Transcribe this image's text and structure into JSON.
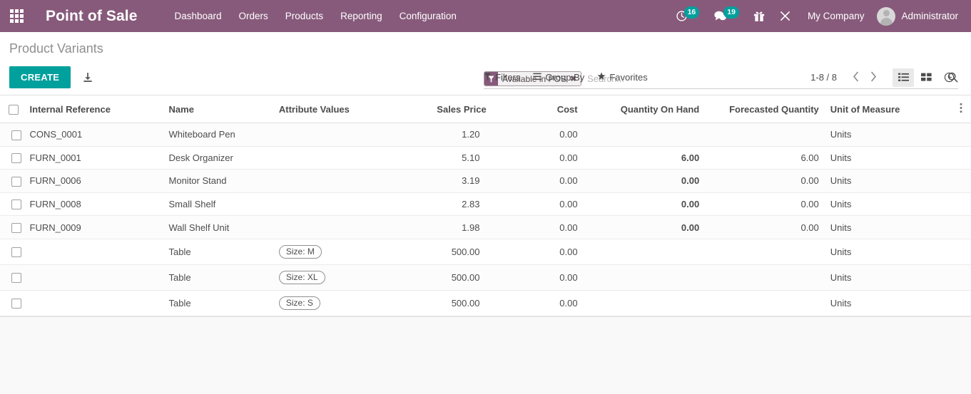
{
  "navbar": {
    "apps_icon": "apps-grid-icon",
    "brand": "Point of Sale",
    "menu": [
      {
        "label": "Dashboard"
      },
      {
        "label": "Orders"
      },
      {
        "label": "Products"
      },
      {
        "label": "Reporting"
      },
      {
        "label": "Configuration"
      }
    ],
    "systray": {
      "activities": {
        "icon": "clock-icon",
        "count": "16"
      },
      "messages": {
        "icon": "chat-bubble-icon",
        "count": "19"
      },
      "gift": {
        "icon": "gift-icon"
      },
      "tools": {
        "icon": "wrench-cross-icon"
      },
      "company": "My Company",
      "avatar_icon": "user-avatar-icon",
      "username": "Administrator"
    }
  },
  "control_panel": {
    "title": "Product Variants",
    "create_label": "CREATE",
    "import_icon": "import-download-icon",
    "search": {
      "facet": {
        "icon": "filter-funnel-icon",
        "label": "Available in POS",
        "close": "✖"
      },
      "placeholder": "Search...",
      "value": "",
      "search_icon": "search-icon"
    },
    "dropdowns": [
      {
        "icon": "filter-funnel-icon",
        "label": "Filters"
      },
      {
        "icon": "list-lines-icon",
        "label": "Group By"
      },
      {
        "icon": "star-icon",
        "label": "Favorites"
      }
    ],
    "pager": {
      "range": "1-8 / 8",
      "prev_icon": "chevron-left-icon",
      "next_icon": "chevron-right-icon"
    },
    "view_switcher": [
      {
        "icon": "list-view-icon",
        "active": true
      },
      {
        "icon": "kanban-view-icon",
        "active": false
      },
      {
        "icon": "activity-clock-view-icon",
        "active": false
      }
    ]
  },
  "list": {
    "select_all_icon": "checkbox-icon",
    "optional_columns_icon": "vertical-dots-icon",
    "columns": [
      {
        "label": "Internal Reference",
        "align": "left"
      },
      {
        "label": "Name",
        "align": "left"
      },
      {
        "label": "Attribute Values",
        "align": "left"
      },
      {
        "label": "Sales Price",
        "align": "right"
      },
      {
        "label": "Cost",
        "align": "right"
      },
      {
        "label": "Quantity On Hand",
        "align": "right"
      },
      {
        "label": "Forecasted Quantity",
        "align": "right"
      },
      {
        "label": "Unit of Measure",
        "align": "left"
      }
    ],
    "rows": [
      {
        "reference": "CONS_0001",
        "name": "Whiteboard Pen",
        "attribute": "",
        "sales_price": "1.20",
        "cost": "0.00",
        "qty_on_hand": "",
        "forecasted": "",
        "uom": "Units",
        "qty_style": "none",
        "forecast_style": "none"
      },
      {
        "reference": "FURN_0001",
        "name": "Desk Organizer",
        "attribute": "",
        "sales_price": "5.10",
        "cost": "0.00",
        "qty_on_hand": "6.00",
        "forecasted": "6.00",
        "uom": "Units",
        "qty_style": "stock",
        "forecast_style": "none"
      },
      {
        "reference": "FURN_0006",
        "name": "Monitor Stand",
        "attribute": "",
        "sales_price": "3.19",
        "cost": "0.00",
        "qty_on_hand": "0.00",
        "forecasted": "0.00",
        "uom": "Units",
        "qty_style": "zero",
        "forecast_style": "zero"
      },
      {
        "reference": "FURN_0008",
        "name": "Small Shelf",
        "attribute": "",
        "sales_price": "2.83",
        "cost": "0.00",
        "qty_on_hand": "0.00",
        "forecasted": "0.00",
        "uom": "Units",
        "qty_style": "zero",
        "forecast_style": "zero"
      },
      {
        "reference": "FURN_0009",
        "name": "Wall Shelf Unit",
        "attribute": "",
        "sales_price": "1.98",
        "cost": "0.00",
        "qty_on_hand": "0.00",
        "forecasted": "0.00",
        "uom": "Units",
        "qty_style": "zero",
        "forecast_style": "zero"
      },
      {
        "reference": "",
        "name": "Table",
        "attribute": "Size: M",
        "sales_price": "500.00",
        "cost": "0.00",
        "qty_on_hand": "",
        "forecasted": "",
        "uom": "Units",
        "qty_style": "none",
        "forecast_style": "none"
      },
      {
        "reference": "",
        "name": "Table",
        "attribute": "Size: XL",
        "sales_price": "500.00",
        "cost": "0.00",
        "qty_on_hand": "",
        "forecasted": "",
        "uom": "Units",
        "qty_style": "none",
        "forecast_style": "none"
      },
      {
        "reference": "",
        "name": "Table",
        "attribute": "Size: S",
        "sales_price": "500.00",
        "cost": "0.00",
        "qty_on_hand": "",
        "forecasted": "",
        "uom": "Units",
        "qty_style": "none",
        "forecast_style": "none"
      }
    ]
  },
  "colors": {
    "brand_purple": "#875A7B",
    "accent_teal": "#00A09D",
    "warning_amber": "#e09b25"
  }
}
